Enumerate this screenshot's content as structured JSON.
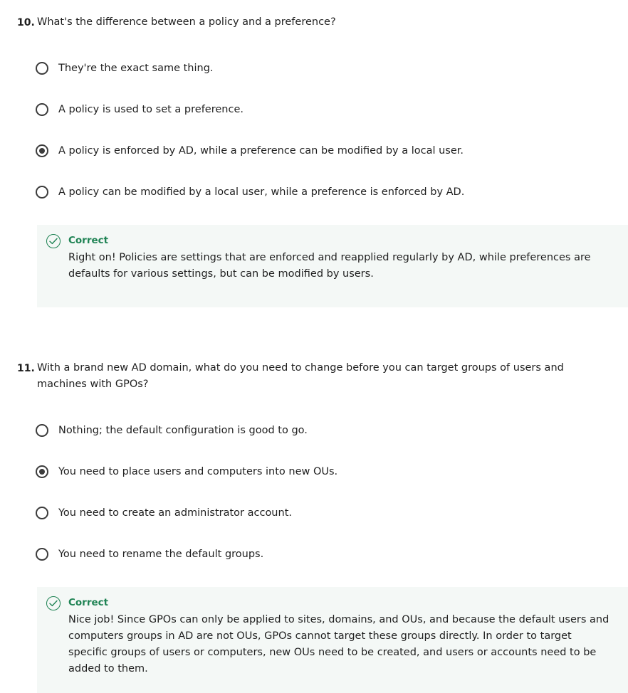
{
  "questions": [
    {
      "number": "10.",
      "text": "What's the difference between a policy and a preference?",
      "options": [
        {
          "label": "They're the exact same thing.",
          "selected": false
        },
        {
          "label": "A policy is used to set a preference.",
          "selected": false
        },
        {
          "label": "A policy is enforced by AD, while a preference can be modified by a local user.",
          "selected": true
        },
        {
          "label": "A policy can be modified by a local user, while a preference is enforced by AD.",
          "selected": false
        }
      ],
      "feedback": {
        "icon": "check-circle-icon",
        "title": "Correct",
        "text": "Right on! Policies are settings that are enforced and reapplied regularly by AD, while preferences are defaults for various settings, but can be modified by users."
      }
    },
    {
      "number": "11.",
      "text": "With a brand new AD domain, what do you need to change before you can target groups of users and machines with GPOs?",
      "options": [
        {
          "label": "Nothing; the default configuration is good to go.",
          "selected": false
        },
        {
          "label": "You need to place users and computers into new OUs.",
          "selected": true
        },
        {
          "label": "You need to create an administrator account.",
          "selected": false
        },
        {
          "label": "You need to rename the default groups.",
          "selected": false
        }
      ],
      "feedback": {
        "icon": "check-circle-icon",
        "title": "Correct",
        "text": "Nice job! Since GPOs can only be applied to sites, domains, and OUs, and because the default users and computers groups in AD are not OUs, GPOs cannot target these groups directly. In order to target specific groups of users or computers, new OUs need to be created, and users or accounts need to be added to them."
      }
    }
  ],
  "colors": {
    "correct": "#1f8354",
    "feedback_bg": "#f4f8f6",
    "radio": "#3c3c3c"
  }
}
